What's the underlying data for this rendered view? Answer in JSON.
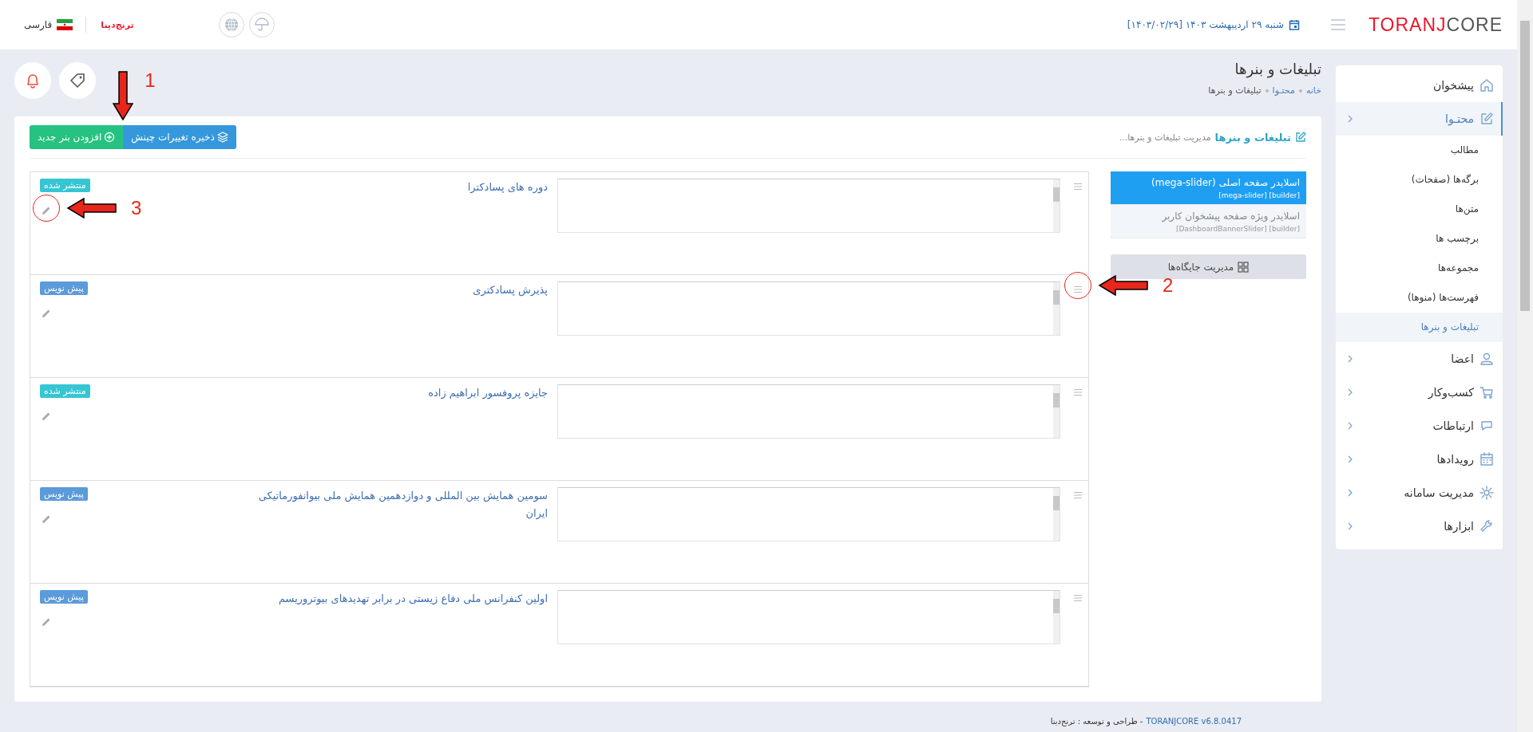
{
  "top_bar": {
    "logo": {
      "part_1": "TORANJ",
      "part_2": "CORE"
    },
    "date": "شنبه ۲۹ اردیبهشت ۱۴۰۳ [۱۴۰۳/۰۲/۲۹]",
    "brand": "ترنج‌دینا",
    "language": "فارسی"
  },
  "page_header": {
    "title": "تبلیغات و بنرها",
    "breadcrumb": [
      {
        "label": "خانه",
        "selected": false
      },
      {
        "label": "محتـوا",
        "selected": false
      },
      {
        "label": "تبلیغات و بنرها",
        "selected": true
      }
    ]
  },
  "card": {
    "title": "تبلیغات و بنرها",
    "subtitle": "مدیریت تبلیغات و بنرها...",
    "buttons": [
      {
        "label": "ذخیره تغییرات چینش",
        "kind": "save"
      },
      {
        "label": "افزودن بنر جدید",
        "kind": "add",
        "callout": "1"
      }
    ]
  },
  "banners": [
    {
      "title": "دوره های پسادکترا",
      "status": {
        "label": "منتشر شده",
        "kind": "published"
      },
      "edit_callout": "3"
    },
    {
      "title": "پذیرش پسادکتری",
      "status": {
        "label": "پیش نویس",
        "kind": "draft"
      },
      "handle_callout": "2"
    },
    {
      "title": "جایزه پروفسور ابراهیم زاده",
      "status": {
        "label": "منتشر شده",
        "kind": "published"
      }
    },
    {
      "title": "سومین همایش بین المللی و دوازدهمین همایش ملی بیوانفورماتیکی ایران",
      "status": {
        "label": "پیش نویس",
        "kind": "draft"
      }
    },
    {
      "title": "اولین کنفرانس ملی دفاع زیستی در برابر تهدیدهای بیوتروریسم",
      "status": {
        "label": "پیش نویس",
        "kind": "draft"
      }
    }
  ],
  "slots": {
    "items": [
      {
        "title": "اسلایدر صفحه اصلی (mega-slider)",
        "tags": "[builder] [mega-slider]",
        "selected": true
      },
      {
        "title": "اسلایدر ویژه صفحه پیشخوان کاربر",
        "tags": "[builder] [DashboardBannerSlider]",
        "selected": false
      }
    ],
    "manage_button": "مدیریت جایگاه‌ها"
  },
  "sidebar": {
    "items": [
      {
        "label": "پیشخوان",
        "submenu": false,
        "expanded": false
      },
      {
        "label": "محتـوا",
        "submenu": true,
        "expanded": true,
        "children": [
          {
            "label": "مطالب",
            "selected": false
          },
          {
            "label": "برگه‌ها (صفحات)",
            "selected": false
          },
          {
            "label": "متن‌ها",
            "selected": false
          },
          {
            "label": "برچسب ها",
            "selected": false
          },
          {
            "label": "مجموعه‌ها",
            "selected": false
          },
          {
            "label": "فهرست‌ها (منوها)",
            "selected": false
          },
          {
            "label": "تبلیغات و بنرها",
            "selected": true
          }
        ]
      },
      {
        "label": "اعضا",
        "submenu": true,
        "expanded": false
      },
      {
        "label": "کسب‌وکار",
        "submenu": true,
        "expanded": false
      },
      {
        "label": "ارتباطات",
        "submenu": true,
        "expanded": false
      },
      {
        "label": "رویدادها",
        "submenu": true,
        "expanded": false
      },
      {
        "label": "مدیریت سامانه",
        "submenu": true,
        "expanded": false
      },
      {
        "label": "ابزارها",
        "submenu": true,
        "expanded": false
      }
    ]
  },
  "footer": {
    "version": "TORANJCORE v6.8.0417",
    "credit": "- طراحی و توسعه : ترنج‌دینا"
  }
}
